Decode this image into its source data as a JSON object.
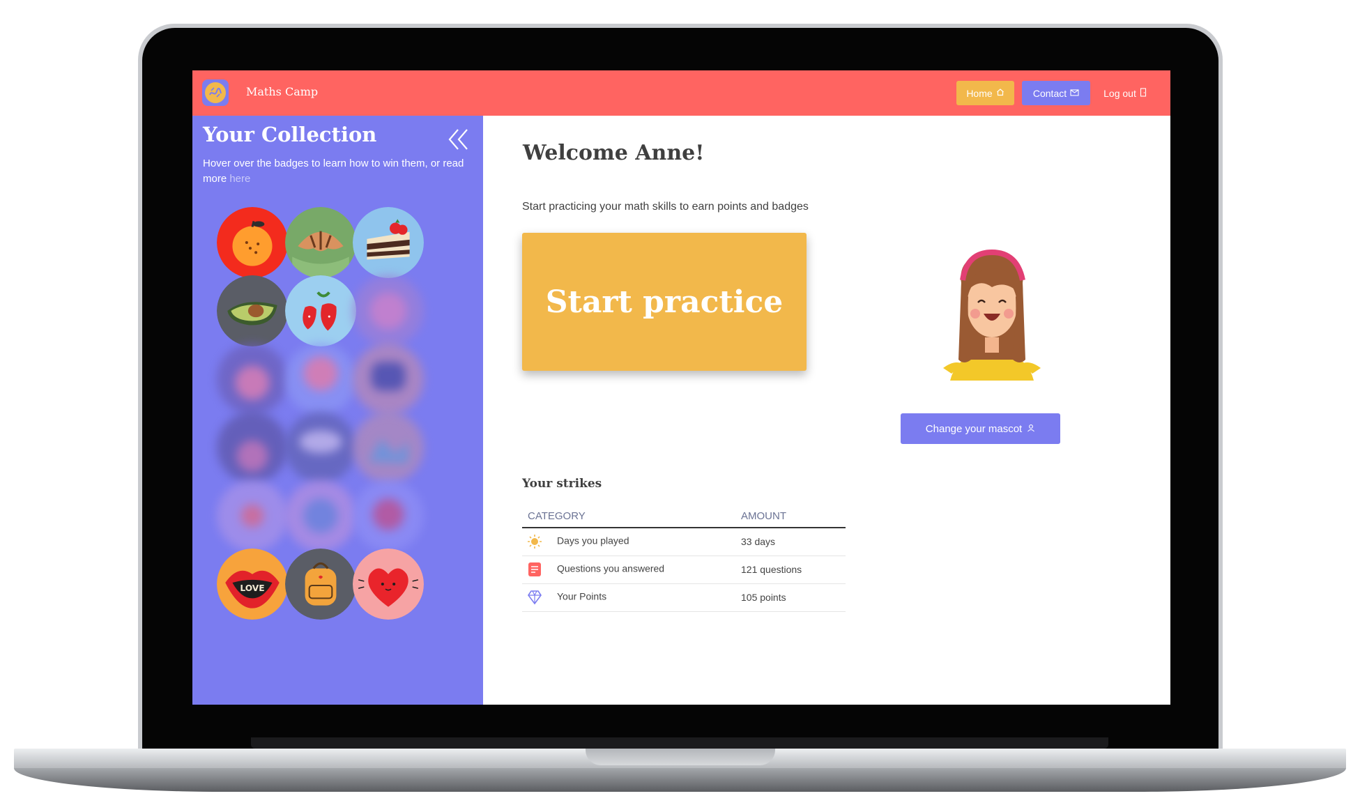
{
  "app": {
    "name": "Maths Camp",
    "colors": {
      "header": "#ff6461",
      "accent_purple": "#7b7cf0",
      "accent_yellow": "#f2b84b"
    }
  },
  "nav": {
    "home_label": "Home",
    "home_icon": "home-icon",
    "contact_label": "Contact",
    "contact_icon": "mail-icon",
    "logout_label": "Log out",
    "logout_icon": "door-icon"
  },
  "sidebar": {
    "title": "Your Collection",
    "help_text": "Hover over the badges to learn how to win them, or read more ",
    "help_link": "here",
    "collapse_icon": "double-chevron-left-icon",
    "badges": [
      {
        "name": "orange",
        "earned": true
      },
      {
        "name": "croissant",
        "earned": true
      },
      {
        "name": "cake",
        "earned": true
      },
      {
        "name": "avocado",
        "earned": true
      },
      {
        "name": "strawberries",
        "earned": true
      },
      {
        "name": "locked-6",
        "earned": false
      },
      {
        "name": "locked-7",
        "earned": false
      },
      {
        "name": "locked-8",
        "earned": false
      },
      {
        "name": "locked-9",
        "earned": false
      },
      {
        "name": "locked-10",
        "earned": false
      },
      {
        "name": "locked-11",
        "earned": false
      },
      {
        "name": "locked-12",
        "earned": false
      },
      {
        "name": "locked-13",
        "earned": false
      },
      {
        "name": "locked-14",
        "earned": false
      },
      {
        "name": "locked-15",
        "earned": false
      },
      {
        "name": "lips",
        "earned": true,
        "text": "LOVE"
      },
      {
        "name": "backpack",
        "earned": true
      },
      {
        "name": "heart",
        "earned": true
      }
    ]
  },
  "main": {
    "welcome": "Welcome Anne!",
    "subtitle": "Start practicing your math skills to earn points and badges",
    "start_label": "Start practice",
    "mascot_button": "Change your mascot",
    "mascot_icon": "user-icon",
    "strikes_title": "Your strikes",
    "table": {
      "headers": [
        "CATEGORY",
        "AMOUNT"
      ],
      "rows": [
        {
          "icon": "sun-icon",
          "category": "Days you played",
          "amount": "33 days"
        },
        {
          "icon": "list-icon",
          "category": "Questions you answered",
          "amount": "121 questions"
        },
        {
          "icon": "diamond-icon",
          "category": "Your Points",
          "amount": "105 points"
        }
      ]
    }
  }
}
